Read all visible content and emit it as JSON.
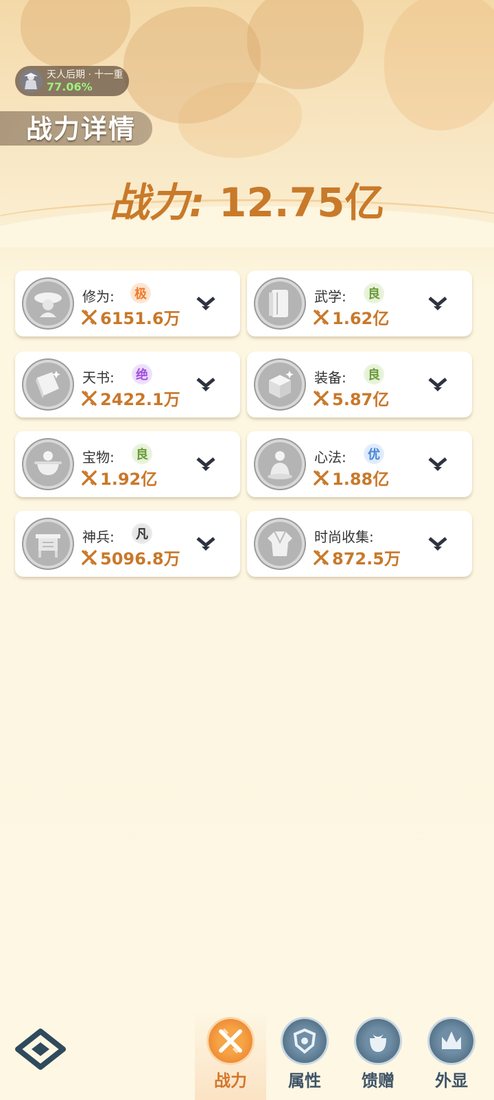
{
  "realm": {
    "name": "天人后期 · 十一重",
    "progress": "77.06%"
  },
  "page_title": "战力详情",
  "total_power": {
    "label": "战力:",
    "value": "12.75亿"
  },
  "cards": [
    {
      "label": "修为:",
      "grade": "极",
      "value": "6151.6万",
      "icon": "cultivator-hat-icon"
    },
    {
      "label": "武学:",
      "grade": "良",
      "value": "1.62亿",
      "icon": "scroll-book-icon"
    },
    {
      "label": "天书:",
      "grade": "绝",
      "value": "2422.1万",
      "icon": "celestial-book-icon"
    },
    {
      "label": "装备:",
      "grade": "良",
      "value": "5.87亿",
      "icon": "equipment-box-icon"
    },
    {
      "label": "宝物:",
      "grade": "良",
      "value": "1.92亿",
      "icon": "treasure-cauldron-icon"
    },
    {
      "label": "心法:",
      "grade": "优",
      "value": "1.88亿",
      "icon": "meditation-figure-icon"
    },
    {
      "label": "神兵:",
      "grade": "凡",
      "value": "5096.8万",
      "icon": "bronze-vessel-icon"
    },
    {
      "label": "时尚收集:",
      "grade": "",
      "value": "872.5万",
      "icon": "fashion-robe-icon"
    }
  ],
  "tabs": [
    {
      "label": "战力",
      "icon": "crossed-swords-icon",
      "active": true
    },
    {
      "label": "属性",
      "icon": "shield-emblem-icon",
      "active": false
    },
    {
      "label": "馈赠",
      "icon": "gift-bag-icon",
      "active": false
    },
    {
      "label": "外显",
      "icon": "crown-icon",
      "active": false
    }
  ],
  "colors": {
    "accent": "#c9782a",
    "tab_active": "#e6772a",
    "tab_inactive": "#3f5b70"
  }
}
